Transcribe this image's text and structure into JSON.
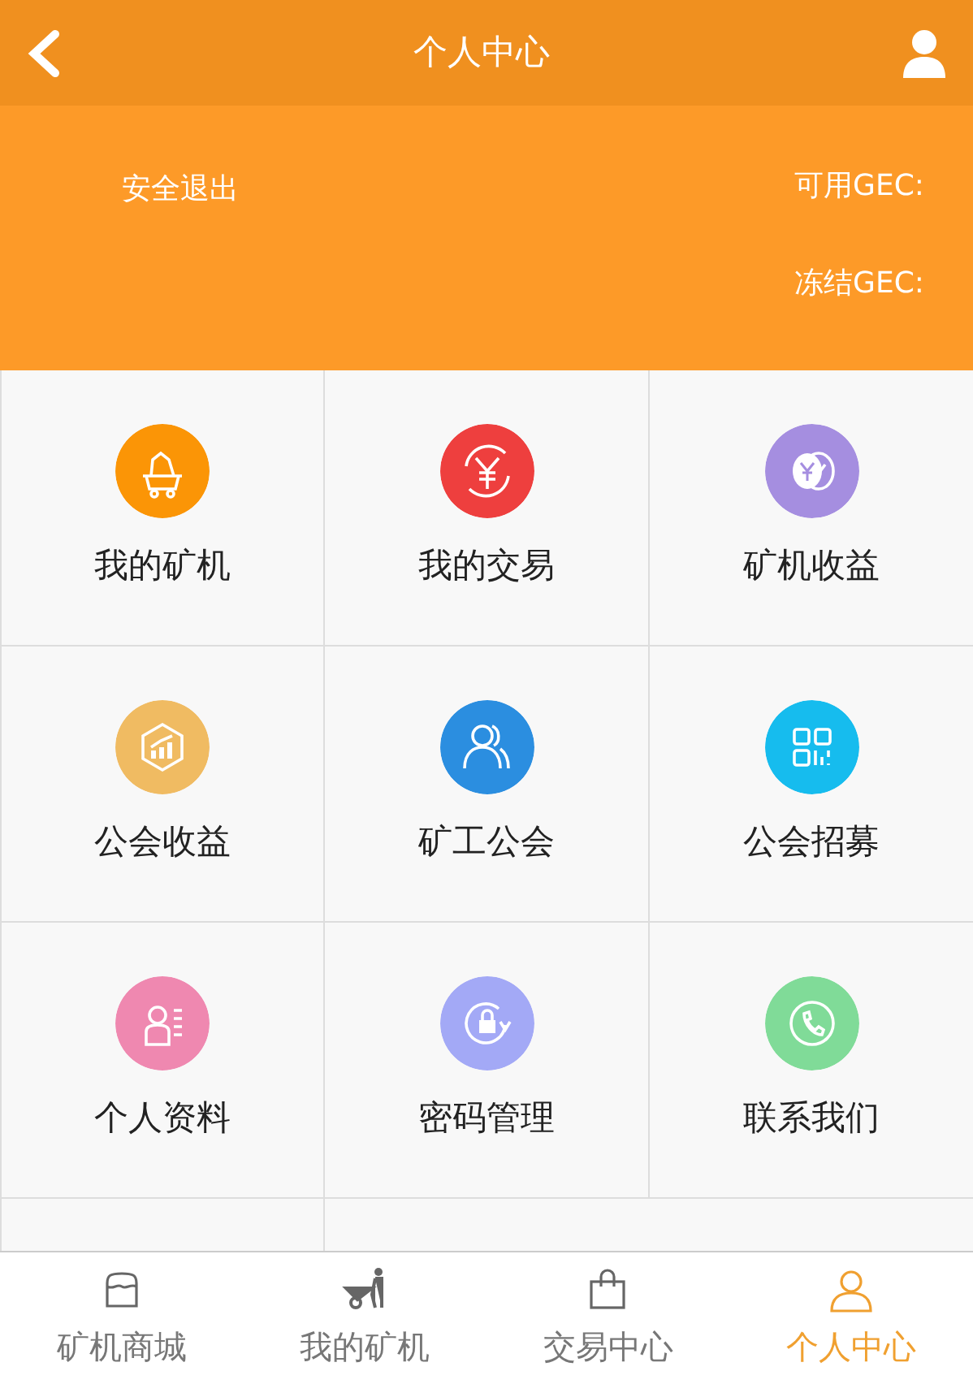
{
  "header": {
    "title": "个人中心"
  },
  "account": {
    "logout": "安全退出",
    "balances": [
      "可用GEC:",
      "冻结GEC:"
    ]
  },
  "menu": [
    {
      "label": "我的矿机",
      "color": "#fb9506"
    },
    {
      "label": "我的交易",
      "color": "#ee3f3e"
    },
    {
      "label": "矿机收益",
      "color": "#a58ee0"
    },
    {
      "label": "公会收益",
      "color": "#f0bb62"
    },
    {
      "label": "矿工公会",
      "color": "#2b8ee0"
    },
    {
      "label": "公会招募",
      "color": "#16bcee"
    },
    {
      "label": "个人资料",
      "color": "#ef88b0"
    },
    {
      "label": "密码管理",
      "color": "#a3a9f6"
    },
    {
      "label": "联系我们",
      "color": "#80db98"
    }
  ],
  "tabs": [
    {
      "label": "矿机商城",
      "selected": false
    },
    {
      "label": "我的矿机",
      "selected": false
    },
    {
      "label": "交易中心",
      "selected": false
    },
    {
      "label": "个人中心",
      "selected": true
    }
  ]
}
